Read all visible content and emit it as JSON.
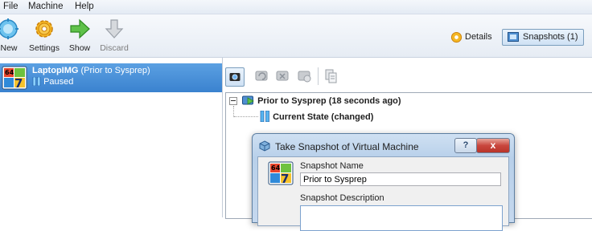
{
  "menu": {
    "items": [
      "File",
      "Machine",
      "Help"
    ]
  },
  "toolbar": {
    "new_label": "New",
    "settings_label": "Settings",
    "show_label": "Show",
    "discard_label": "Discard",
    "details_label": "Details",
    "snapshots_label": "Snapshots (1)"
  },
  "vm_list": {
    "items": [
      {
        "name": "LaptopIMG",
        "suffix": "(Prior to Sysprep)",
        "state": "Paused",
        "os_badge_top": "64",
        "os_badge_main": "7"
      }
    ]
  },
  "snapshot_tree": {
    "snapshot_label": "Prior to Sysprep (18 seconds ago)",
    "current_state_label": "Current State (changed)"
  },
  "dialog": {
    "title": "Take Snapshot of Virtual Machine",
    "name_label": "Snapshot Name",
    "name_value": "Prior to Sysprep",
    "description_label": "Snapshot Description",
    "help_label": "?",
    "close_label": "x"
  },
  "colors": {
    "selection": "#3a82cf",
    "close_button": "#c9463d",
    "accent": "#2f6fb5"
  },
  "icons": [
    "new-icon",
    "settings-icon",
    "show-icon",
    "discard-icon",
    "details-icon",
    "snapshots-icon",
    "windows7-64-icon",
    "paused-icon",
    "take-snapshot-icon",
    "restore-snapshot-icon",
    "delete-snapshot-icon",
    "snapshot-details-icon",
    "clone-icon"
  ]
}
